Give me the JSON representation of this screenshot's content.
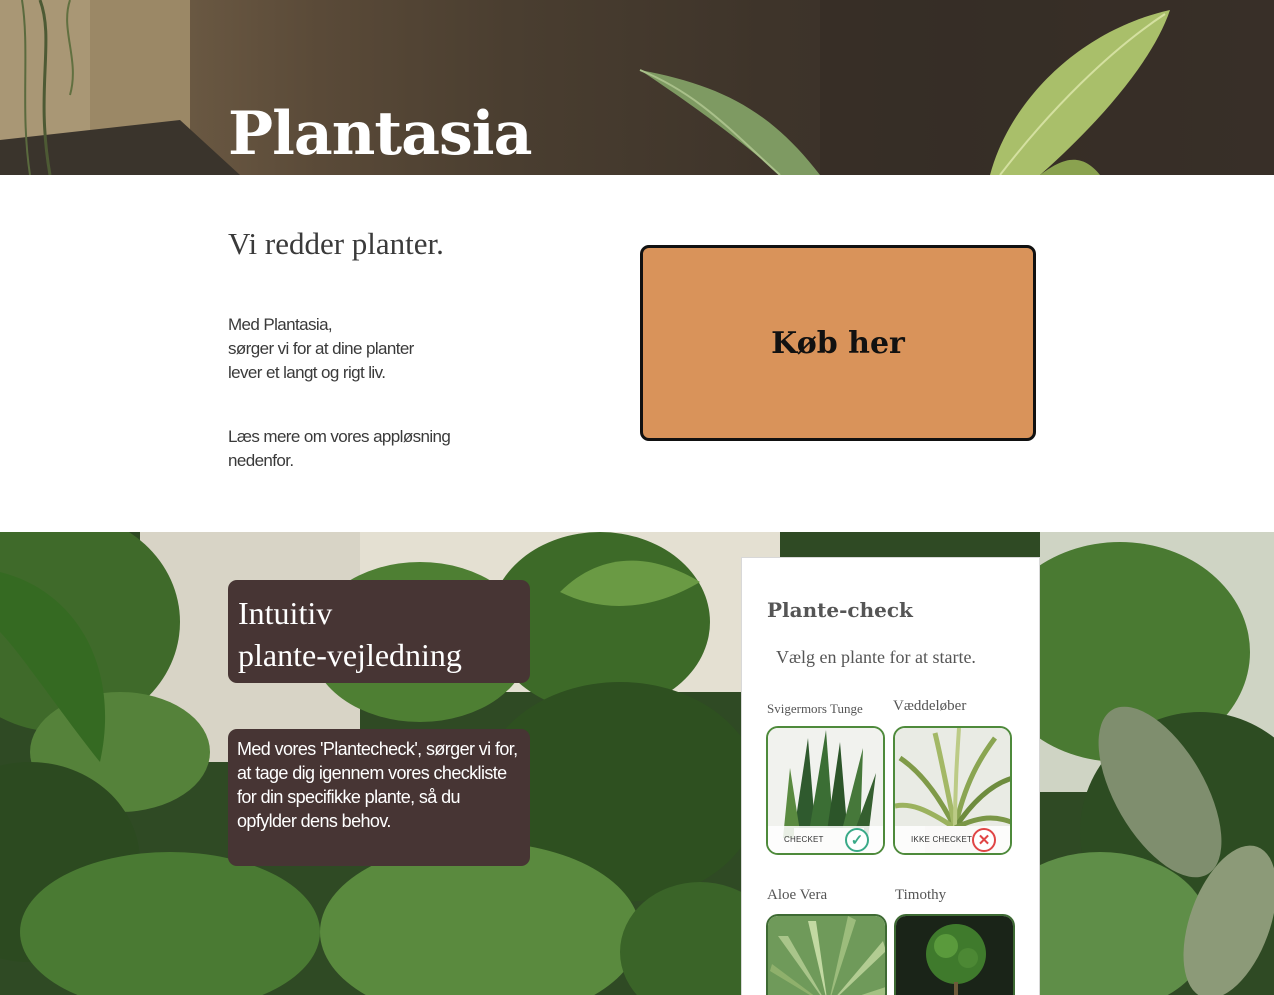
{
  "hero": {
    "title": "Plantasia"
  },
  "intro": {
    "tagline": "Vi redder planter.",
    "lines": [
      "Med Plantasia,",
      "sørger vi for at dine planter",
      "lever et langt og rigt liv."
    ],
    "read_more": "Læs mere om vores appløsning nedenfor.",
    "buy_label": "Køb her"
  },
  "feature": {
    "title_line1": "Intuitiv",
    "title_line2": "plante-vejledning",
    "description": "Med vores 'Plantecheck', sørger vi for, at tage dig igennem vores checkliste for din specifikke plante, så du opfylder dens behov."
  },
  "app": {
    "title": "Plante-check",
    "subtitle": "Vælg en plante for at starte.",
    "plants": [
      {
        "name": "Svigermors Tunge",
        "status": "CHECKET",
        "checked": true,
        "icon": "checkmark-icon"
      },
      {
        "name": "Væddeløber",
        "status": "IKKE CHECKET",
        "checked": false,
        "icon": "cross-icon"
      },
      {
        "name": "Aloe Vera"
      },
      {
        "name": "Timothy"
      }
    ]
  },
  "colors": {
    "accent": "#d9935a",
    "panel": "#473534",
    "card_border": "#4e8a3b"
  }
}
